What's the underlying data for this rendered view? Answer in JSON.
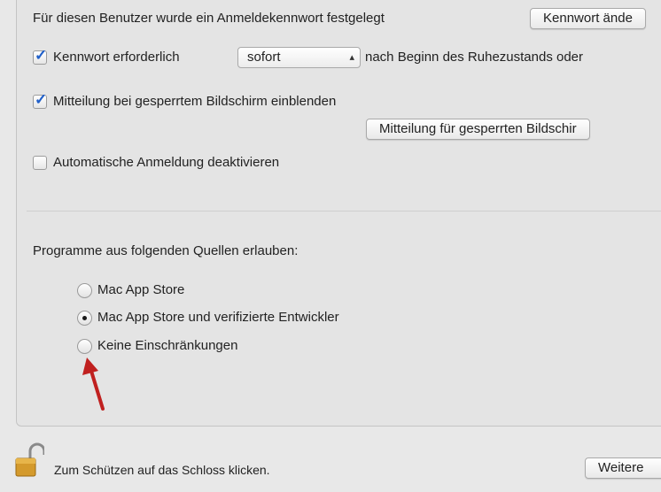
{
  "password_row": {
    "label": "Für diesen Benutzer wurde ein Anmeldekennwort festgelegt",
    "change_button": "Kennwort ände"
  },
  "require_password": {
    "checked": true,
    "label": "Kennwort erforderlich",
    "select_value": "sofort",
    "suffix": "nach Beginn des Ruhezustands oder"
  },
  "lock_message": {
    "checked": true,
    "label": "Mitteilung bei gesperrtem Bildschirm einblenden",
    "button": "Mitteilung für gesperrten Bildschir"
  },
  "auto_login": {
    "checked": false,
    "label": "Automatische Anmeldung deaktivieren"
  },
  "gatekeeper": {
    "heading": "Programme aus folgenden Quellen erlauben:",
    "options": [
      {
        "label": "Mac App Store",
        "selected": false
      },
      {
        "label": "Mac App Store und verifizierte Entwickler",
        "selected": true
      },
      {
        "label": "Keine Einschränkungen",
        "selected": false
      }
    ]
  },
  "footer": {
    "lock_text": "Zum Schützen auf das Schloss klicken.",
    "more_button": "Weitere"
  },
  "colors": {
    "accent": "#1f5fc9",
    "annotation_arrow": "#c0201f"
  }
}
